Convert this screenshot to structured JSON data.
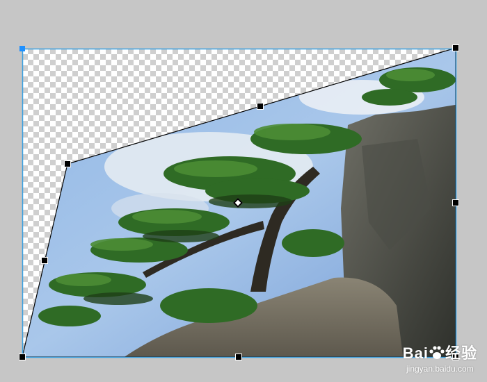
{
  "canvas": {
    "background_color": "#c6c6c6",
    "selection_color": "#3aa0e0",
    "handle_color": "#000000"
  },
  "transform_tool": {
    "mode": "distort",
    "handles": [
      "top-left",
      "top-middle",
      "top-right",
      "middle-left",
      "middle-right",
      "bottom-left",
      "bottom-middle",
      "bottom-right"
    ],
    "pivot": "center-pivot"
  },
  "image": {
    "subject": "pine tree on rocky cliff against blue sky"
  },
  "watermark": {
    "brand_prefix": "Bai",
    "brand_suffix": "经验",
    "url": "jingyan.baidu.com",
    "icon": "paw-icon"
  }
}
